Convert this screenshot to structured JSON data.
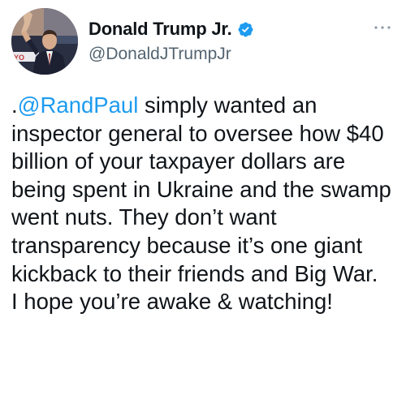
{
  "author": {
    "display_name": "Donald Trump Jr.",
    "handle": "@DonaldJTrumpJr",
    "verified": true,
    "avatar_icon": "profile-photo",
    "avatar_partial_text": "YO"
  },
  "tweet": {
    "prefix": ".",
    "mention": "@RandPaul",
    "body": " simply wanted an inspector general to oversee how $40 billion of your taxpayer dollars are being spent in Ukraine and the swamp went nuts. They don’t want transparency because it’s one giant kickback to their friends and Big War.\nI hope you’re awake & watching!"
  },
  "icons": {
    "verified": "verified-badge-icon",
    "more": "more-options-icon"
  },
  "colors": {
    "text": "#0f1419",
    "secondary": "#536471",
    "link": "#1d9bf0",
    "verified": "#1d9bf0",
    "more_dots": "#8b98a5"
  }
}
